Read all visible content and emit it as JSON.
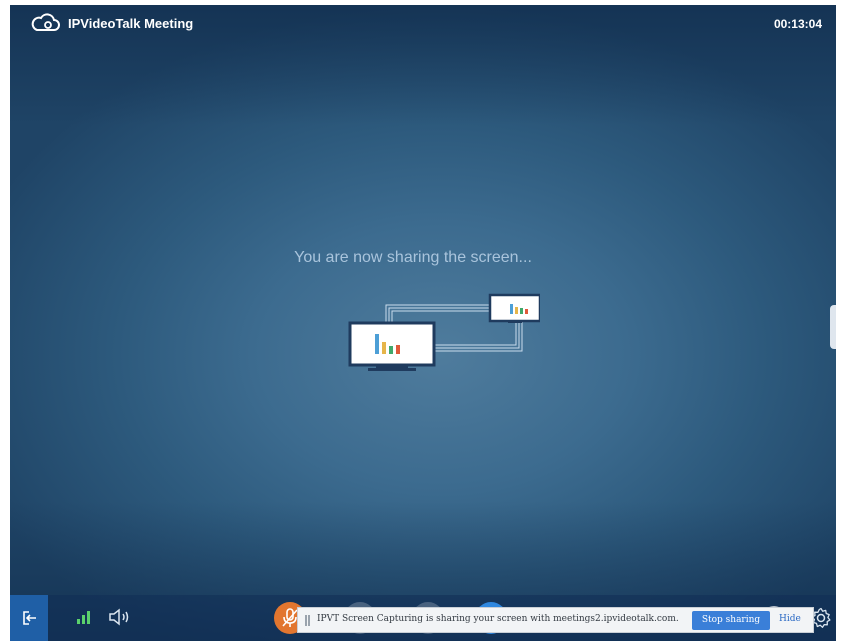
{
  "window": {
    "title": "IPVideoTalk Meeting",
    "elapsed_time": "00:13:04"
  },
  "main": {
    "message": "You are now sharing the screen..."
  },
  "icons": {
    "logo": "cloud-logo-icon",
    "exit": "exit-meeting-icon",
    "signal": "signal-strength-icon",
    "speaker": "speaker-icon",
    "mic": "microphone-muted-icon",
    "camera": "camera-icon",
    "hand": "raise-hand-icon",
    "share": "share-screen-icon",
    "info": "info-icon",
    "settings": "gear-icon"
  },
  "capture_bar": {
    "text": "IPVT Screen Capturing is sharing your screen with meetings2.ipvideotalk.com.",
    "stop_label": "Stop sharing",
    "hide_label": "Hide"
  },
  "colors": {
    "mic_button": "#e2762f",
    "share_button": "#2f88e0",
    "exit_button": "#1f5fa6",
    "signal_green": "#5bd16c",
    "stop_button": "#3a7fd8"
  }
}
